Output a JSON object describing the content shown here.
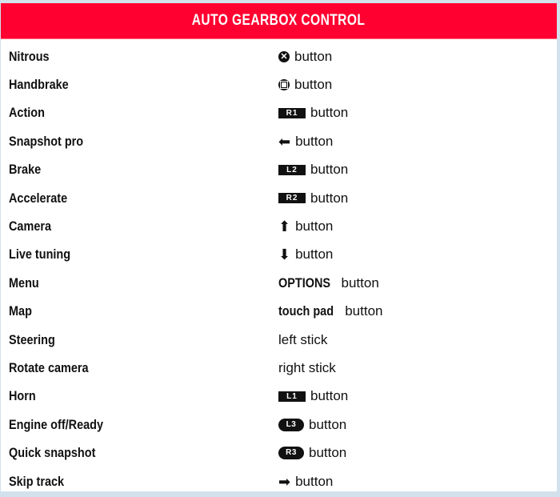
{
  "header": {
    "title": "AUTO GEARBOX CONTROL"
  },
  "colors": {
    "header_bg": "#ff0030",
    "page_bg": "#d3e1ec"
  },
  "rows": [
    {
      "action": "Nitrous",
      "icon": "cross-button-icon",
      "icon_text": "✕",
      "control_bold": "",
      "control": "button"
    },
    {
      "action": "Handbrake",
      "icon": "square-button-icon",
      "icon_text": "",
      "control_bold": "",
      "control": "button"
    },
    {
      "action": "Action",
      "icon": "r1-button-icon",
      "icon_text": "R1",
      "control_bold": "",
      "control": "button"
    },
    {
      "action": "Snapshot pro",
      "icon": "arrow-left-icon",
      "icon_text": "⬅",
      "control_bold": "",
      "control": "button"
    },
    {
      "action": "Brake",
      "icon": "l2-button-icon",
      "icon_text": "L2",
      "control_bold": "",
      "control": "button"
    },
    {
      "action": "Accelerate",
      "icon": "r2-button-icon",
      "icon_text": "R2",
      "control_bold": "",
      "control": "button"
    },
    {
      "action": "Camera",
      "icon": "arrow-up-icon",
      "icon_text": "⬆",
      "control_bold": "",
      "control": "button"
    },
    {
      "action": "Live tuning",
      "icon": "arrow-down-icon",
      "icon_text": "⬇",
      "control_bold": "",
      "control": "button"
    },
    {
      "action": "Menu",
      "icon": "",
      "icon_text": "",
      "control_bold": "OPTIONS",
      "control": "button"
    },
    {
      "action": "Map",
      "icon": "",
      "icon_text": "",
      "control_bold": "touch pad",
      "control": "button"
    },
    {
      "action": "Steering",
      "icon": "",
      "icon_text": "",
      "control_bold": "",
      "control": "left stick"
    },
    {
      "action": "Rotate camera",
      "icon": "",
      "icon_text": "",
      "control_bold": "",
      "control": "right stick"
    },
    {
      "action": "Horn",
      "icon": "l1-button-icon",
      "icon_text": "L1",
      "control_bold": "",
      "control": "button"
    },
    {
      "action": "Engine off/Ready",
      "icon": "l3-button-icon",
      "icon_text": "L3",
      "control_bold": "",
      "control": "button"
    },
    {
      "action": "Quick snapshot",
      "icon": "r3-button-icon",
      "icon_text": "R3",
      "control_bold": "",
      "control": "button"
    },
    {
      "action": "Skip track",
      "icon": "arrow-right-icon",
      "icon_text": "➡",
      "control_bold": "",
      "control": "button"
    }
  ]
}
